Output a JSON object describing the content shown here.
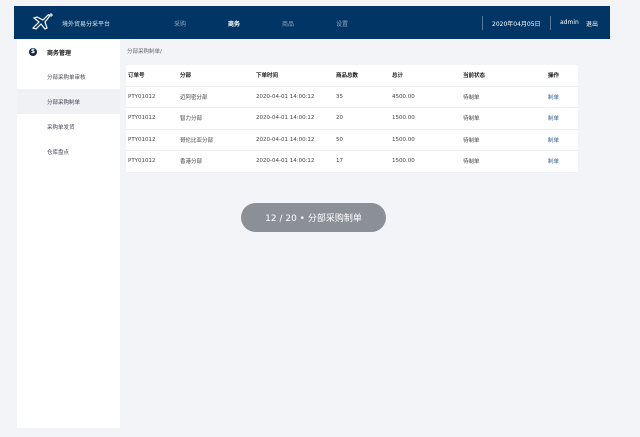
{
  "header": {
    "title": "境外贸易分采平台",
    "nav": [
      {
        "label": "采购",
        "active": false
      },
      {
        "label": "商务",
        "active": true
      },
      {
        "label": "商品",
        "active": false
      },
      {
        "label": "设置",
        "active": false
      }
    ],
    "date": "2020年04月05日",
    "user": "admin",
    "logout": "退出"
  },
  "sidebar": {
    "group": "商务管理",
    "group_icon": "dollar-icon",
    "items": [
      {
        "label": "分部采购单审核"
      },
      {
        "label": "分部采购制单",
        "selected": true
      },
      {
        "label": "采购单发货"
      },
      {
        "label": "仓库盘点"
      }
    ]
  },
  "breadcrumb": "分部采购制单/",
  "table": {
    "columns": [
      "订单号",
      "分部",
      "下单时间",
      "商品总数",
      "总计",
      "当前状态",
      "操作"
    ],
    "rows": [
      [
        "PTY01012",
        "迈阿密分部",
        "2020-04-01 14:00:12",
        "35",
        "4500.00",
        "待制单",
        "制单"
      ],
      [
        "PTY01012",
        "智力分部",
        "2020-04-01 14:00:12",
        "20",
        "1500.00",
        "待制单",
        "制单"
      ],
      [
        "PTY01012",
        "哥伦比亚分部",
        "2020-04-01 14:00:12",
        "50",
        "1500.00",
        "待制单",
        "制单"
      ],
      [
        "PTY01012",
        "香港分部",
        "2020-04-01 14:00:12",
        "17",
        "1500.00",
        "待制单",
        "制单"
      ]
    ]
  },
  "toast": "12 / 20 • 分部采购制单",
  "colors": {
    "header": "#003566",
    "link": "#2f5c8f",
    "toast": "#8b9097"
  }
}
